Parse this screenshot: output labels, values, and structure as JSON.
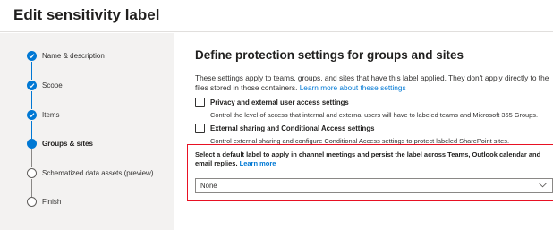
{
  "header": {
    "title": "Edit sensitivity label"
  },
  "wizard": {
    "steps": [
      {
        "label": "Name & description",
        "state": "done"
      },
      {
        "label": "Scope",
        "state": "done"
      },
      {
        "label": "Items",
        "state": "done"
      },
      {
        "label": "Groups & sites",
        "state": "current"
      },
      {
        "label": "Schematized data assets (preview)",
        "state": "todo"
      },
      {
        "label": "Finish",
        "state": "todo"
      }
    ]
  },
  "main": {
    "title": "Define protection settings for groups and sites",
    "description": "These settings apply to teams, groups, and sites that have this label applied. They don't apply directly to the files stored in those containers.",
    "learn_more_link": "Learn more about these settings",
    "options": [
      {
        "title": "Privacy and external user access settings",
        "subtitle": "Control the level of access that internal and external users will have to labeled teams and Microsoft 365 Groups."
      },
      {
        "title": "External sharing and Conditional Access settings",
        "subtitle": "Control external sharing and configure Conditional Access settings to protect labeled SharePoint sites."
      }
    ],
    "default_label": {
      "prompt": "Select a default label to apply in channel meetings and persist the label across Teams, Outlook calendar and email replies.",
      "learn_more": "Learn more",
      "selected_value": "None"
    }
  },
  "colors": {
    "accent": "#0078d4",
    "highlight_box": "#e81123",
    "wizard_bg": "#f3f2f1"
  }
}
